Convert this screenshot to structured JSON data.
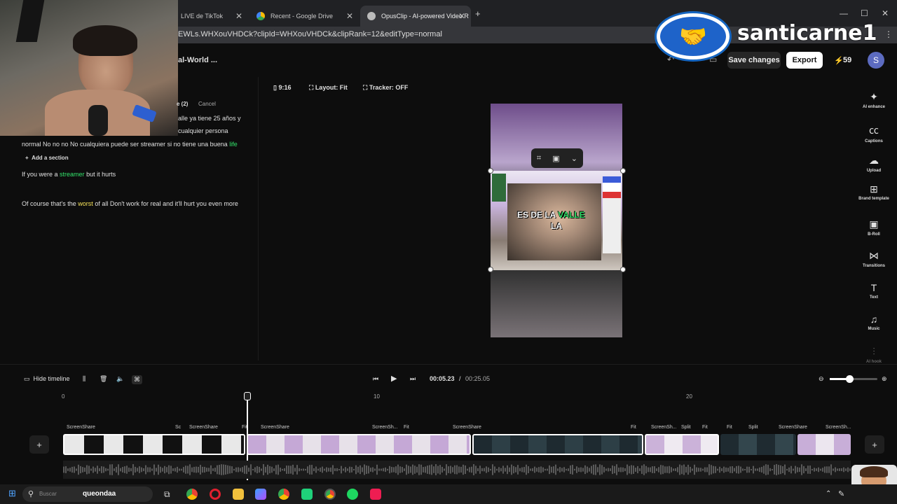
{
  "browser": {
    "tabs": [
      {
        "label": "LIVE de TikTok",
        "visible_label": "LIVE de TikTok"
      },
      {
        "label": "Recent - Google Drive"
      },
      {
        "label": "OpusClip - AI-powered Video R"
      }
    ],
    "new_tab": "+",
    "url": "EWLs.WHXouVHDCk?clipId=WHXouVHDCk&clipRank=12&editType=normal"
  },
  "overlay": {
    "channel_name": "santicarne1"
  },
  "header": {
    "project_title": "al-World ...",
    "save_label": "Save changes",
    "export_label": "Export",
    "credits": "59",
    "avatar_letter": "S"
  },
  "transcript": {
    "edit_count": "e (2)",
    "cancel_label": "Cancel",
    "lines": [
      "alle ya tiene 25 años y",
      "cualquier persona",
      "normal No no no No cualquiera puede ser streamer si no tiene una buena",
      "life",
      "Add a section",
      "If you were a",
      "streamer",
      "but it hurts",
      "Of course that's the",
      "worst",
      "of all Don't work for real and it'll hurt you even more"
    ]
  },
  "toolbar": {
    "ratio": "9:16",
    "layout": "Layout: Fit",
    "tracker": "Tracker: OFF"
  },
  "preview": {
    "caption_1a": "ES DE LA",
    "caption_1b": "VALLE",
    "caption_2": "LA"
  },
  "sidebar": {
    "items": [
      "AI enhance",
      "Captions",
      "Upload",
      "Brand template",
      "B-Roll",
      "Transitions",
      "Text",
      "Music",
      "AI hook"
    ]
  },
  "timeline": {
    "hide_label": "Hide timeline",
    "current_time": "00:05.23",
    "separator": "/",
    "total_time": "00:25.05",
    "ruler": [
      "0",
      "10",
      "20"
    ],
    "clip_labels": [
      "ScreenShare",
      "Sc",
      "ScreenShare",
      "Fit",
      "ScreenShare",
      "ScreenSh...",
      "Fit",
      "ScreenShare",
      "Fit",
      "ScreenSh...",
      "Split",
      "Fit",
      "Fit",
      "Split",
      "ScreenShare",
      "ScreenSh..."
    ],
    "add_symbol": "+"
  },
  "taskbar": {
    "search_label": "Buscar",
    "user_label": "queondaa"
  },
  "colors": {
    "accent_green": "#33e36b",
    "highlight_yellow": "#f5e25a",
    "credit_bolt": "#f5c518",
    "avatar": "#5c6bc0"
  }
}
